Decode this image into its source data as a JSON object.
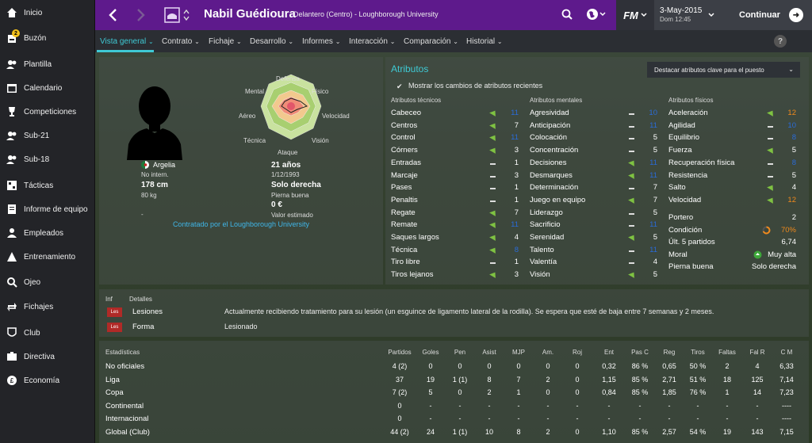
{
  "sidebar": {
    "items": [
      {
        "label": "Inicio",
        "icon": "home-icon"
      },
      {
        "label": "Buzón",
        "icon": "inbox-icon",
        "badge": "2"
      },
      {
        "label": "Plantilla",
        "icon": "squad-icon"
      },
      {
        "label": "Calendario",
        "icon": "calendar-icon"
      },
      {
        "label": "Competiciones",
        "icon": "trophy-icon"
      },
      {
        "label": "Sub-21",
        "icon": "u21-icon"
      },
      {
        "label": "Sub-18",
        "icon": "u18-icon"
      },
      {
        "label": "Tácticas",
        "icon": "tactics-icon"
      },
      {
        "label": "Informe de equipo",
        "icon": "report-icon"
      },
      {
        "label": "Empleados",
        "icon": "staff-icon"
      },
      {
        "label": "Entrenamiento",
        "icon": "training-icon"
      },
      {
        "label": "Ojeo",
        "icon": "scouting-icon"
      },
      {
        "label": "Fichajes",
        "icon": "transfers-icon"
      },
      {
        "label": "Club",
        "icon": "club-icon"
      },
      {
        "label": "Directiva",
        "icon": "board-icon"
      },
      {
        "label": "Economía",
        "icon": "finance-icon"
      }
    ]
  },
  "header": {
    "player_name": "Nabil Guédioura",
    "subtitle": "Delantero (Centro) - Loughborough University",
    "logo": "FM",
    "date": "3-May-2015",
    "time": "Dom 12:45",
    "continue": "Continuar",
    "purple": "#5e1a8c"
  },
  "subnav": {
    "tabs": [
      "Vista general",
      "Contrato",
      "Fichaje",
      "Desarrollo",
      "Informes",
      "Interacción",
      "Comparación",
      "Historial"
    ],
    "help": "?"
  },
  "profile": {
    "radar_labels": {
      "top": "Defensa",
      "tr": "Físico",
      "r": "Velocidad",
      "br": "Visión",
      "bottom": "Ataque",
      "bl": "Técnica",
      "l": "Aéreo",
      "tl": "Mental"
    },
    "nation": "Argelia",
    "intl": "No intern.",
    "height": "178 cm",
    "weight": "80 kg",
    "dash": "-",
    "age": "21 años",
    "dob": "1/12/1993",
    "foot": "Solo derecha",
    "foot_sub": "Pierna buena",
    "value": "0 €",
    "value_sub": "Valor estimado",
    "contracted": "Contratado por el Loughborough University"
  },
  "attributes": {
    "title": "Atributos",
    "dropdown": "Destacar atributos clave para el puesto",
    "show_changes": "Mostrar los cambios de atributos recientes",
    "headers": [
      "Atributos técnicos",
      "Atributos mentales",
      "Atributos físicos"
    ],
    "technical": [
      [
        "Cabeceo",
        "up",
        "11",
        "b"
      ],
      [
        "Centros",
        "up",
        "7",
        ""
      ],
      [
        "Control",
        "up",
        "11",
        "b"
      ],
      [
        "Córners",
        "up",
        "3",
        ""
      ],
      [
        "Entradas",
        "dash",
        "1",
        ""
      ],
      [
        "Marcaje",
        "dash",
        "3",
        ""
      ],
      [
        "Pases",
        "dash",
        "1",
        ""
      ],
      [
        "Penaltis",
        "dash",
        "1",
        ""
      ],
      [
        "Regate",
        "up",
        "7",
        ""
      ],
      [
        "Remate",
        "up",
        "11",
        "b"
      ],
      [
        "Saques largos",
        "up",
        "4",
        ""
      ],
      [
        "Técnica",
        "up",
        "8",
        "b"
      ],
      [
        "Tiro libre",
        "dash",
        "1",
        ""
      ],
      [
        "Tiros lejanos",
        "up",
        "3",
        ""
      ]
    ],
    "mental": [
      [
        "Agresividad",
        "dash",
        "10",
        "b"
      ],
      [
        "Anticipación",
        "dash",
        "11",
        "b"
      ],
      [
        "Colocación",
        "dash",
        "5",
        ""
      ],
      [
        "Concentración",
        "dash",
        "5",
        ""
      ],
      [
        "Decisiones",
        "up",
        "11",
        "b"
      ],
      [
        "Desmarques",
        "up",
        "11",
        "b"
      ],
      [
        "Determinación",
        "dash",
        "7",
        ""
      ],
      [
        "Juego en equipo",
        "up",
        "7",
        ""
      ],
      [
        "Liderazgo",
        "dash",
        "5",
        ""
      ],
      [
        "Sacrificio",
        "dash",
        "11",
        "b"
      ],
      [
        "Serenidad",
        "up",
        "5",
        ""
      ],
      [
        "Talento",
        "dash",
        "11",
        "b"
      ],
      [
        "Valentía",
        "dash",
        "4",
        ""
      ],
      [
        "Visión",
        "up",
        "5",
        ""
      ]
    ],
    "physical": [
      [
        "Aceleración",
        "up",
        "12",
        "o"
      ],
      [
        "Agilidad",
        "dash",
        "10",
        "b"
      ],
      [
        "Equilibrio",
        "dash",
        "8",
        "b"
      ],
      [
        "Fuerza",
        "up",
        "5",
        ""
      ],
      [
        "Recuperación física",
        "dash",
        "8",
        "b"
      ],
      [
        "Resistencia",
        "dash",
        "5",
        ""
      ],
      [
        "Salto",
        "up",
        "4",
        ""
      ],
      [
        "Velocidad",
        "up",
        "12",
        "o"
      ]
    ],
    "extra": [
      [
        "Portero",
        "2"
      ],
      [
        "Condición",
        "70%"
      ],
      [
        "Últ. 5 partidos",
        "6,74"
      ],
      [
        "Moral",
        "Muy alta"
      ],
      [
        "Pierna buena",
        "Solo derecha"
      ]
    ]
  },
  "injuries": {
    "headers": [
      "Inf",
      "Detalles"
    ],
    "tag": "Les",
    "rows": [
      [
        "Lesiones",
        "Actualmente recibiendo tratamiento para su lesión (un esguince de ligamento lateral de la rodilla). Se espera que esté de baja entre 7 semanas y 2 meses."
      ],
      [
        "Forma",
        "Lesionado"
      ]
    ]
  },
  "stats": {
    "headers": [
      "Estadísticas",
      "Partidos",
      "Goles",
      "Pen",
      "Asist",
      "MJP",
      "Am.",
      "Roj",
      "Ent",
      "Pas C",
      "Reg",
      "Tiros",
      "Faltas",
      "Fal R",
      "C M"
    ],
    "rows": [
      [
        "No oficiales",
        "4 (2)",
        "0",
        "0",
        "0",
        "0",
        "0",
        "0",
        "0,32",
        "86 %",
        "0,65",
        "50 %",
        "2",
        "4",
        "6,33"
      ],
      [
        "Liga",
        "37",
        "19",
        "1 (1)",
        "8",
        "7",
        "2",
        "0",
        "1,15",
        "85 %",
        "2,71",
        "51 %",
        "18",
        "125",
        "7,14"
      ],
      [
        "Copa",
        "7 (2)",
        "5",
        "0",
        "2",
        "1",
        "0",
        "0",
        "0,84",
        "85 %",
        "1,85",
        "76 %",
        "1",
        "14",
        "7,23"
      ],
      [
        "Continental",
        "0",
        "-",
        "-",
        "-",
        "-",
        "-",
        "-",
        "-",
        "-",
        "-",
        "-",
        "-",
        "-",
        "----"
      ],
      [
        "Internacional",
        "0",
        "-",
        "-",
        "-",
        "-",
        "-",
        "-",
        "-",
        "-",
        "-",
        "-",
        "-",
        "-",
        "----"
      ],
      [
        "Global (Club)",
        "44 (2)",
        "24",
        "1 (1)",
        "10",
        "8",
        "2",
        "0",
        "1,10",
        "85 %",
        "2,57",
        "54 %",
        "19",
        "143",
        "7,15"
      ]
    ]
  }
}
